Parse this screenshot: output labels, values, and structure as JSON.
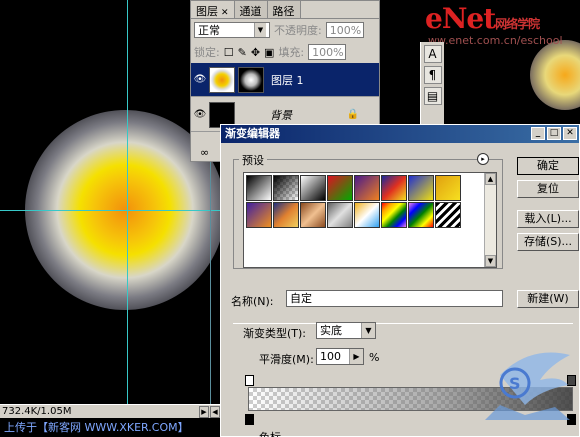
{
  "canvas": {
    "status": "732.4K/1.05M"
  },
  "footer": {
    "caption": "上传于【新客网 WWW.XKER.COM】"
  },
  "watermark": {
    "brand": "eNet",
    "brand_sub": "网络学院",
    "url": "ww.enet.com.cn/eschool"
  },
  "layers_panel": {
    "tabs": [
      {
        "label": "图层"
      },
      {
        "label": "通道"
      },
      {
        "label": "路径"
      }
    ],
    "blend_mode": "正常",
    "opacity_label": "不透明度:",
    "opacity_value": "100%",
    "lock_label": "锁定:",
    "fill_label": "填充:",
    "fill_value": "100%",
    "layers": [
      {
        "name": "图层 1",
        "selected": true
      },
      {
        "name": "背景",
        "selected": false
      }
    ]
  },
  "gradient_editor": {
    "title": "渐变编辑器",
    "presets_label": "预设",
    "buttons": {
      "ok": "确定",
      "reset": "复位",
      "load": "载入(L)...",
      "save": "存储(S)...",
      "new": "新建(W)"
    },
    "name_label": "名称(N):",
    "name_value": "自定",
    "type_label": "渐变类型(T):",
    "type_value": "实底",
    "smooth_label": "平滑度(M):",
    "smooth_value": "100",
    "smooth_unit": "%",
    "bottom_label": "色标"
  },
  "colors": {
    "accent": "#0a246a",
    "guide": "#37c8c8"
  }
}
